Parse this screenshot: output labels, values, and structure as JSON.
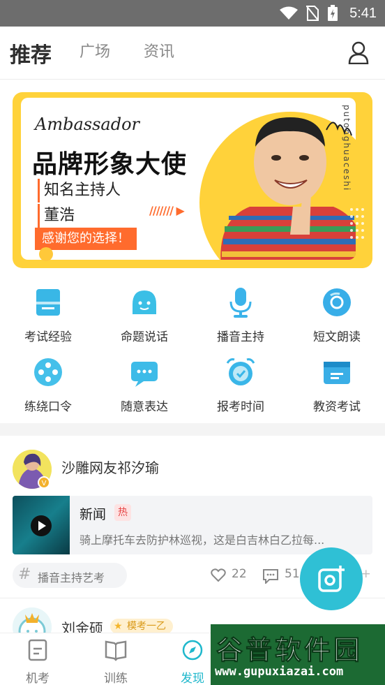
{
  "status_bar": {
    "time": "5:41",
    "icons": [
      "wifi-icon",
      "no-sim-icon",
      "battery-charging-icon"
    ]
  },
  "top_nav": {
    "tabs": [
      {
        "label": "推荐",
        "active": true
      },
      {
        "label": "广场",
        "active": false
      },
      {
        "label": "资讯",
        "active": false
      }
    ],
    "profile_icon": "person-outline-icon"
  },
  "banner": {
    "ambassador": "Ambassador",
    "headline": "品牌形象大使",
    "host_title": "知名主持人",
    "host_name": "董浩",
    "thanks": "感谢您的选择！",
    "vertical_text": "putonghuaceshi",
    "colors": {
      "frame": "#ffd23a",
      "accent": "#ff6b2d"
    }
  },
  "features": [
    {
      "label": "考试经验",
      "icon": "exam-notebook-icon",
      "color": "#39b7e6"
    },
    {
      "label": "命题说话",
      "icon": "chat-smile-icon",
      "color": "#3bbfe6"
    },
    {
      "label": "播音主持",
      "icon": "microphone-icon",
      "color": "#3bb3ea"
    },
    {
      "label": "短文朗读",
      "icon": "reading-disc-icon",
      "color": "#38aee8"
    },
    {
      "label": "练绕口令",
      "icon": "film-reel-icon",
      "color": "#45c0ea"
    },
    {
      "label": "随意表达",
      "icon": "speech-dots-icon",
      "color": "#3dbbe8"
    },
    {
      "label": "报考时间",
      "icon": "alarm-clock-icon",
      "color": "#3ab6e8"
    },
    {
      "label": "教资考试",
      "icon": "certificate-card-icon",
      "color": "#3aaee6"
    }
  ],
  "post": {
    "username": "沙雕网友祁汐瑜",
    "news": {
      "title": "新闻",
      "hot_badge": "热",
      "desc": "骑上摩托车去防护林巡视，这是白吉林白乙拉每..."
    },
    "tag": "播音主持艺考",
    "likes": "22",
    "comments": "51",
    "shares": "99+"
  },
  "post2": {
    "username": "刘金硕",
    "badge": "模考一乙"
  },
  "bottom_nav": [
    {
      "label": "机考",
      "icon": "exam-doc-icon",
      "active": false
    },
    {
      "label": "训练",
      "icon": "open-book-icon",
      "active": false
    },
    {
      "label": "发现",
      "icon": "compass-icon",
      "active": true
    }
  ],
  "watermark": {
    "title": "谷普软件园",
    "url": "www.gupuxiazai.com"
  },
  "accent_color": "#2fc0d5"
}
